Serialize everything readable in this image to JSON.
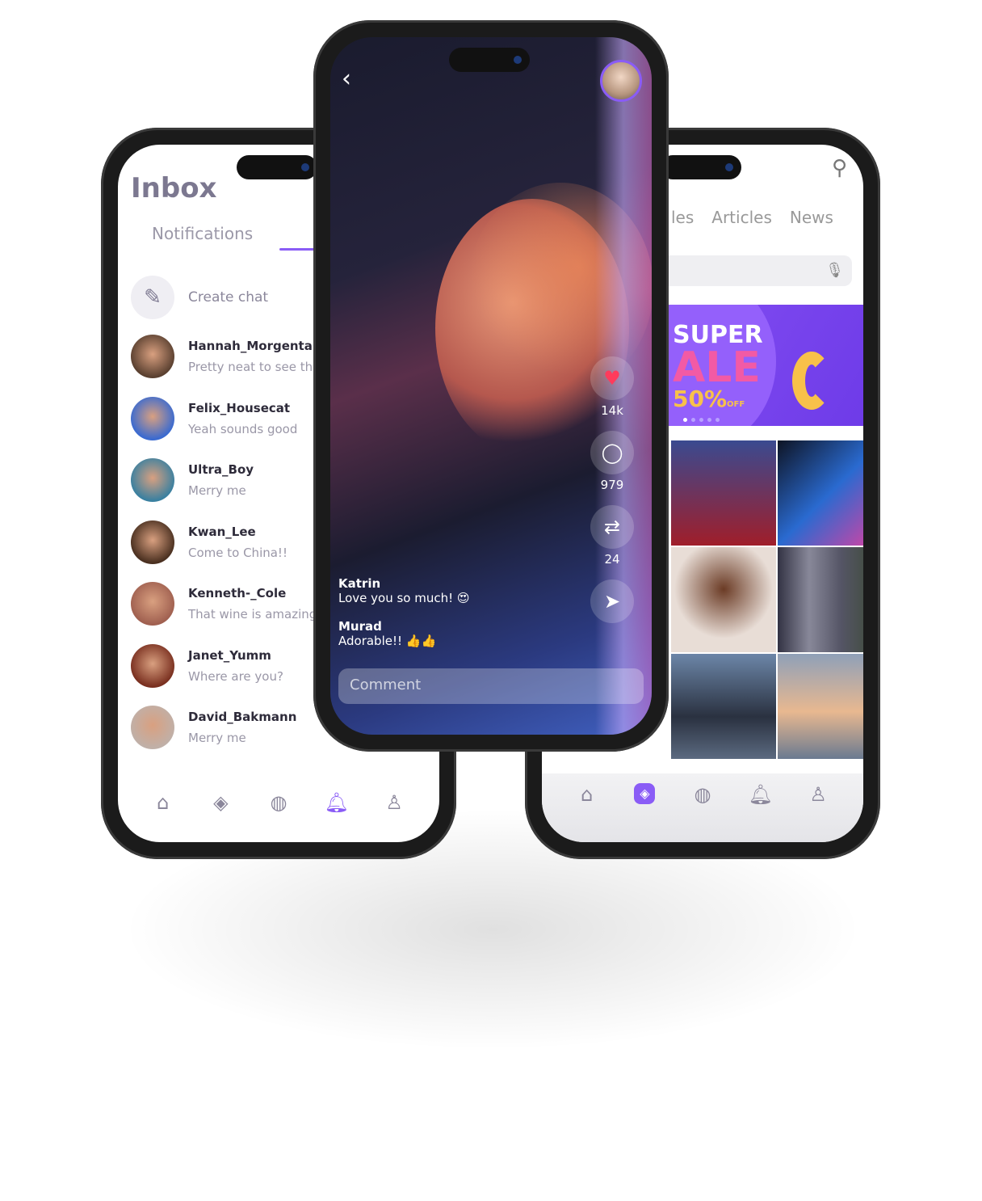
{
  "inbox": {
    "title": "Inbox",
    "tab": "Notifications",
    "create_chat": "Create chat",
    "chats": [
      {
        "name": "Hannah_Morgental",
        "message": "Pretty neat to see the"
      },
      {
        "name": "Felix_Housecat",
        "message": "Yeah sounds good"
      },
      {
        "name": "Ultra_Boy",
        "message": "Merry me"
      },
      {
        "name": "Kwan_Lee",
        "message": "Come to China!!"
      },
      {
        "name": "Kenneth-_Cole",
        "message": "That wine is amazing!"
      },
      {
        "name": "Janet_Yumm",
        "message": "Where are you?"
      },
      {
        "name": "David_Bakmann",
        "message": "Merry me"
      }
    ],
    "nav": [
      "home-icon",
      "compass-icon",
      "globe-icon",
      "bell-icon",
      "user-icon"
    ],
    "active_nav": "bell-icon"
  },
  "explore": {
    "tabs": [
      "les",
      "Articles",
      "News"
    ],
    "banner": {
      "line1": "SUPER",
      "line2": "ALE",
      "line3": "50%",
      "off": "OFF"
    },
    "active_nav": "compass-icon"
  },
  "post": {
    "likes": "14k",
    "comments": "979",
    "shares": "24",
    "comment_list": [
      {
        "user": "Katrin",
        "text": "Love you so much! 😍"
      },
      {
        "user": "Murad",
        "text": "Adorable!! 👍👍"
      }
    ],
    "comment_placeholder": "Comment"
  },
  "colors": {
    "accent": "#8a5cf6",
    "heart": "#ff3b5c"
  }
}
